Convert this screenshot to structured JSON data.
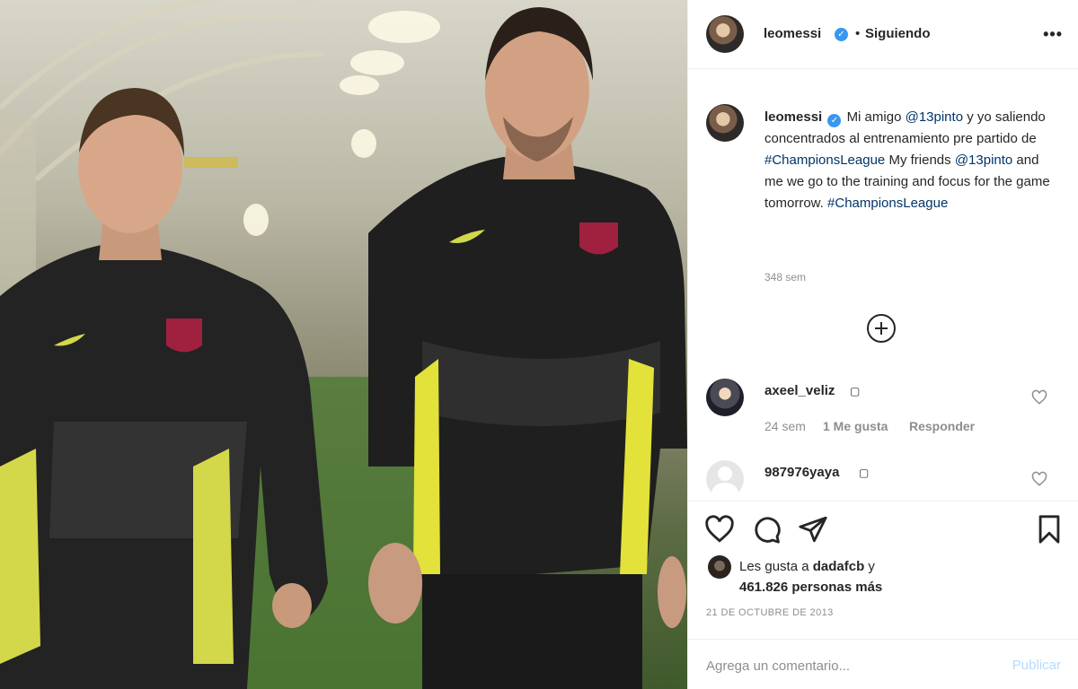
{
  "post": {
    "image_alt": "Dos jugadores con chaquetas negras de entrenamiento caminando por un túnel",
    "author": "leomessi",
    "follow_separator": "•",
    "follow_status": "Siguiendo",
    "more_label": "•••",
    "caption": {
      "username": "leomessi",
      "parts": [
        {
          "text": "Mi amigo ",
          "link": false
        },
        {
          "text": "@13pinto",
          "link": true
        },
        {
          "text": " y yo saliendo concentrados al entrenamiento pre partido de ",
          "link": false
        },
        {
          "text": "#ChampionsLeague",
          "link": true
        },
        {
          "text": " My friends ",
          "link": false
        },
        {
          "text": "@13pinto",
          "link": true
        },
        {
          "text": " and me we go to the training and focus for the game tomorrow. ",
          "link": false
        },
        {
          "text": "#ChampionsLeague",
          "link": true
        }
      ],
      "time": "348 sem"
    },
    "comments": [
      {
        "username": "axeel_veliz",
        "emoji": "▢",
        "time": "24 sem",
        "likes": "1 Me gusta",
        "reply": "Responder"
      },
      {
        "username": "987976yaya",
        "emoji": "▢"
      }
    ],
    "likes": {
      "prefix": "Les gusta a ",
      "user": "dadafcb",
      "suffix": " y",
      "count_text": "461.826 personas más"
    },
    "date": "21 DE OCTUBRE DE 2013",
    "comment_placeholder": "Agrega un comentario...",
    "publish_label": "Publicar"
  },
  "icons": {
    "verified": "verified-badge-icon",
    "like": "heart-icon",
    "comment": "comment-bubble-icon",
    "share": "paper-plane-icon",
    "save": "bookmark-icon",
    "load_more": "plus-circle-icon"
  },
  "colors": {
    "link": "#003569",
    "verified": "#3897f0",
    "muted": "#8e8e8e",
    "publish_disabled": "#b3dbff"
  }
}
